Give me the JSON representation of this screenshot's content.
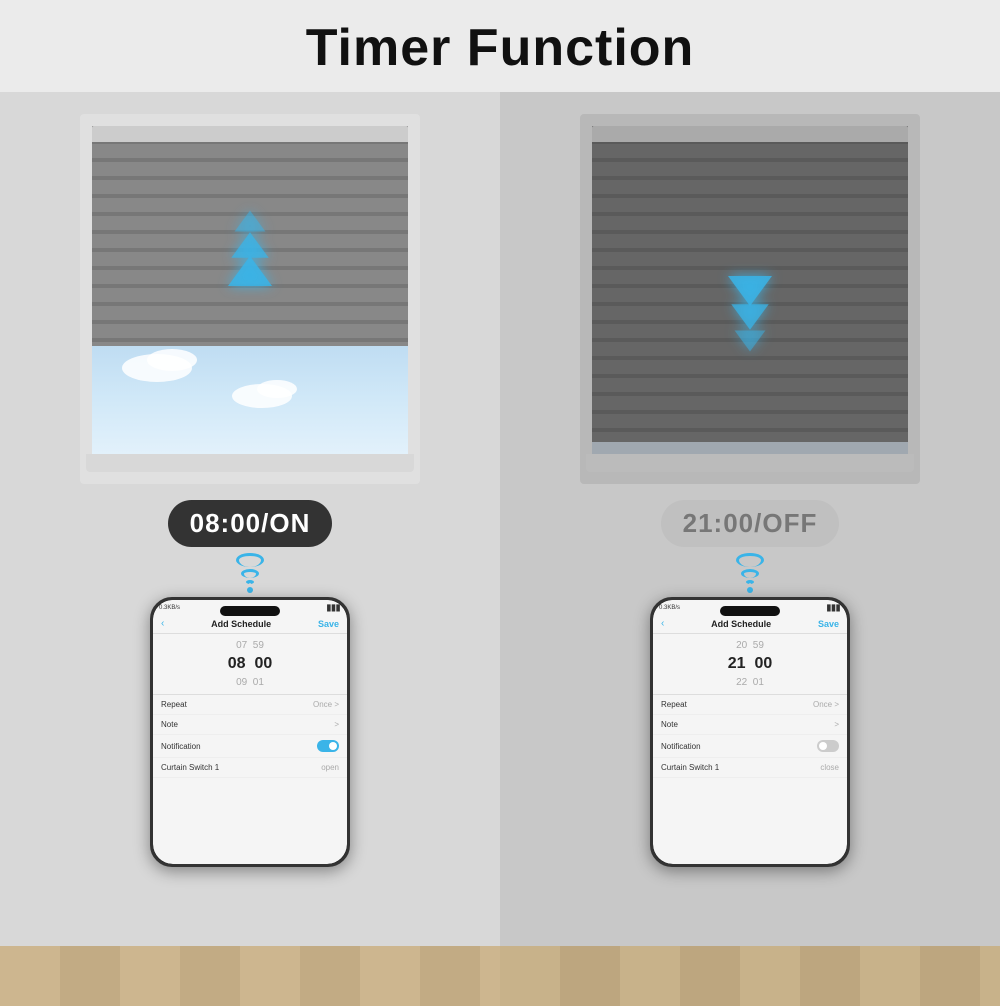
{
  "title": "Timer Function",
  "panel_left": {
    "timer_label": "08:00/ON",
    "arrows_direction": "up",
    "time_rows": [
      "07  59",
      "08  00",
      "09  01"
    ],
    "time_main": "08  00",
    "schedule_title": "Add Schedule",
    "save_label": "Save",
    "settings": [
      {
        "label": "Repeat",
        "value": "Once >"
      },
      {
        "label": "Note",
        "value": ">"
      },
      {
        "label": "Notification",
        "value": "toggle_on"
      },
      {
        "label": "Curtain Switch 1",
        "value": "open"
      }
    ]
  },
  "panel_right": {
    "timer_label": "21:00/OFF",
    "arrows_direction": "down",
    "time_rows": [
      "20  59",
      "21  00",
      "22  01"
    ],
    "time_main": "21  00",
    "schedule_title": "Add Schedule",
    "save_label": "Save",
    "settings": [
      {
        "label": "Repeat",
        "value": "Once >"
      },
      {
        "label": "Note",
        "value": ">"
      },
      {
        "label": "Notification",
        "value": "toggle_off"
      },
      {
        "label": "Curtain Switch 1",
        "value": "close"
      }
    ]
  }
}
